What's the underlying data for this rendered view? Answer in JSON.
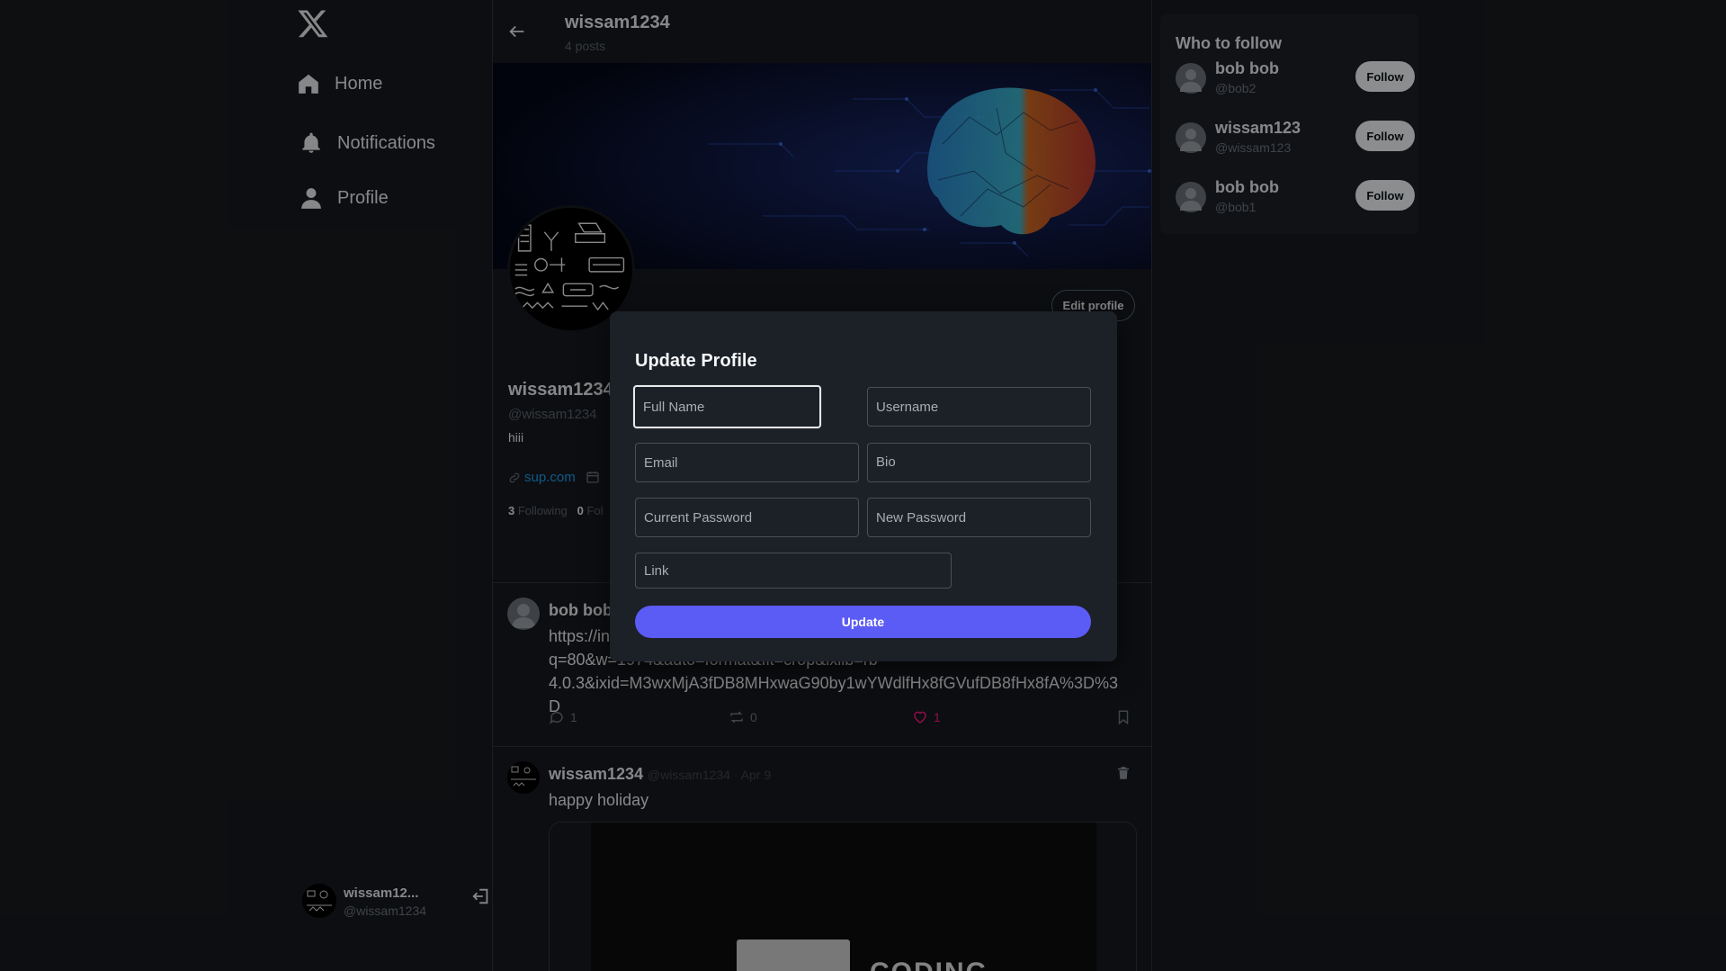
{
  "sidebar": {
    "nav": [
      {
        "label": "Home",
        "icon": "home-icon"
      },
      {
        "label": "Notifications",
        "icon": "bell-icon"
      },
      {
        "label": "Profile",
        "icon": "user-icon"
      }
    ],
    "user": {
      "name": "wissam12...",
      "handle": "@wissam1234"
    }
  },
  "header": {
    "title": "wissam1234",
    "subtitle": "4 posts"
  },
  "profile": {
    "edit_label": "Edit profile",
    "name": "wissam1234",
    "handle": "@wissam1234",
    "bio": "hiii",
    "link": "sup.com",
    "following_count": "3",
    "following_label": "Following",
    "followers_count": "0",
    "followers_label": "Fol"
  },
  "posts": [
    {
      "name": "bob bob",
      "text": "https://images.unsplash.com/photo-1712240001000-a8c4f0b0d6f4?q=80&w=1974&auto=format&fit=crop&ixlib=rb-4.0.3&ixid=M3wxMjA3fDB8MHxwaG90by1wYWdlfHx8fGVufDB8fHx8fA%3D%3D",
      "line1": "https://in",
      "line2": "q=80&w=1974&auto=format&fit=crop&ixlib=rb-",
      "line3": "4.0.3&ixid=M3wxMjA3fDB8MHxwaG90by1wYWdlfHx8fGVufDB8fHx8fA%3D%3D",
      "comments": "1",
      "reposts": "0",
      "likes": "1"
    },
    {
      "name": "wissam1234",
      "meta": "@wissam1234 · Apr 9",
      "text": "happy holiday",
      "image_caption": "CODING"
    }
  ],
  "who_to_follow": {
    "title": "Who to follow",
    "follow_label": "Follow",
    "users": [
      {
        "name": "bob bob",
        "handle": "@bob2"
      },
      {
        "name": "wissam123",
        "handle": "@wissam123"
      },
      {
        "name": "bob bob",
        "handle": "@bob1"
      }
    ]
  },
  "modal": {
    "title": "Update Profile",
    "fields": {
      "full_name": {
        "placeholder": "Full Name",
        "value": ""
      },
      "username": {
        "placeholder": "Username",
        "value": ""
      },
      "email": {
        "placeholder": "Email",
        "value": ""
      },
      "bio": {
        "placeholder": "Bio",
        "value": ""
      },
      "current_password": {
        "placeholder": "Current Password",
        "value": ""
      },
      "new_password": {
        "placeholder": "New Password",
        "value": ""
      },
      "link": {
        "placeholder": "Link",
        "value": ""
      }
    },
    "submit_label": "Update"
  },
  "colors": {
    "background": "#16191e",
    "panel": "#1c1f26",
    "accent_button": "#5b5bf6",
    "link": "#1d9bf0",
    "like": "#f91880",
    "muted_text": "#5c636a"
  }
}
